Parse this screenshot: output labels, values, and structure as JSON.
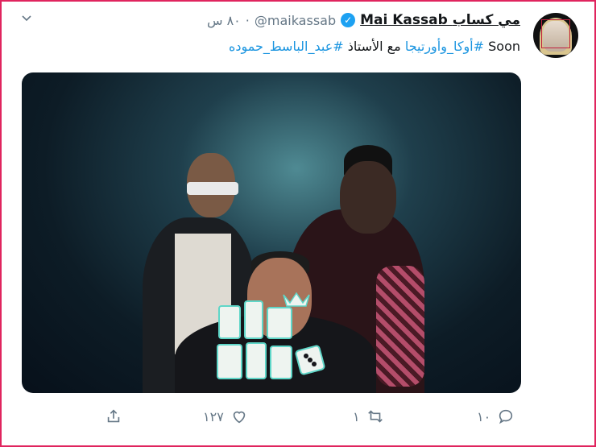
{
  "tweet": {
    "display_name": "Mai Kassab مي كساب",
    "handle": "@maikassab",
    "time": "٨٠ س",
    "text_prefix": "Soon",
    "hashtag_1": "#أوكا_وأورتيجا",
    "text_middle": "مع الأستاذ",
    "hashtag_2": "#عبد_الباسط_حموده"
  },
  "actions": {
    "reply_count": "١٠",
    "retweet_count": "١",
    "like_count": "١٢٧",
    "share_count": ""
  },
  "icons": [
    "chevron-down-icon",
    "verified-icon",
    "reply-icon",
    "retweet-icon",
    "like-icon",
    "share-icon"
  ],
  "colors": {
    "frame": "#e0245e",
    "link": "#1b95e0",
    "verified": "#1da1f2",
    "muted": "#657786"
  }
}
